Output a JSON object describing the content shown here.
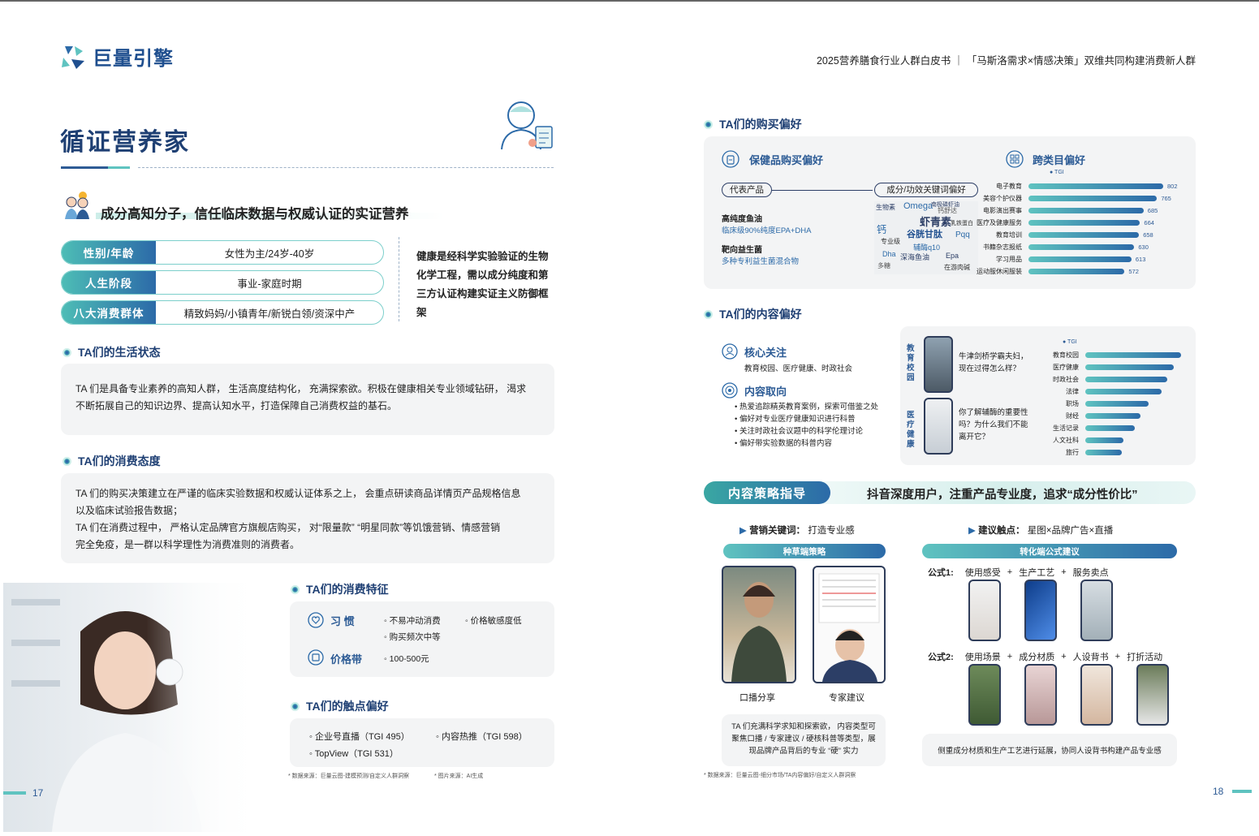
{
  "header": {
    "logo": "巨量引擎",
    "right": "2025营养膳食行业人群白皮书 ｜ 「马斯洛需求×情感决策」双维共同构建消费新人群"
  },
  "left": {
    "title": "循证营养家",
    "subhead": "成分高知分子，信任临床数据与权威认证的实证营养",
    "profile": [
      {
        "tag": "性别/年龄",
        "value": "女性为主/24岁-40岁"
      },
      {
        "tag": "人生阶段",
        "value": "事业-家庭时期"
      },
      {
        "tag": "八大消费群体",
        "value": "精致妈妈/小镇青年/新锐白领/资深中产"
      }
    ],
    "health_lines": [
      "健康是经科学实验验证的生物",
      "化学工程，需以成分纯度和第",
      "三方认证构建实证主义防御框",
      "架"
    ],
    "life": {
      "title": "TA们的生活状态",
      "lines": [
        "TA 们是具备专业素养的高知人群， 生活高度结构化， 充满探索欲。积极在健康相关专业领域钻研， 渴求",
        "不断拓展自己的知识边界、提高认知水平，打造保障自己消费权益的基石。"
      ]
    },
    "attitude": {
      "title": "TA们的消费态度",
      "lines": [
        "TA 们的购买决策建立在严谨的临床实验数据和权威认证体系之上，  会重点研读商品详情页产品规格信息",
        "以及临床试验报告数据；",
        "TA 们在消费过程中， 严格认定品牌官方旗舰店购买， 对“限量款” “明星同款”等饥饿营销、情感营销",
        "完全免疫，是一群以科学理性为消费准则的消费者。"
      ]
    },
    "features": {
      "title": "TA们的消费特征",
      "habit_label": "习  惯",
      "habit_items": [
        "◦ 不易冲动消费",
        "◦ 价格敏感度低",
        "◦ 购买频次中等"
      ],
      "price_label": "价格带",
      "price_item": "◦ 100-500元"
    },
    "touch": {
      "title": "TA们的触点偏好",
      "items": [
        "◦ 企业号直播（TGI 495）",
        "◦ 内容热推（TGI 598）",
        "◦ TopView（TGI 531）"
      ]
    },
    "source1": "* 数据来源：巨量云图-建模预测/自定义人群洞察",
    "source2": "* 图片来源：AI生成",
    "page": "17"
  },
  "right": {
    "purchase": {
      "title": "TA们的购买偏好",
      "health_title": "保健品购买偏好",
      "cross_title": "跨类目偏好",
      "rep_label": "代表产品",
      "kw_label": "成分/功效关键词偏好",
      "products": [
        {
          "name": "高纯度鱼油",
          "desc": "临床级90%纯度EPA+DHA"
        },
        {
          "name": "靶向益生菌",
          "desc": "多种专利益生菌混合物"
        }
      ],
      "wordcloud": [
        "生物素",
        "Omega",
        "钙舒达",
        "南极磷虾油",
        "虾青素",
        "谷胱甘肽",
        "钙",
        "辅酶q10",
        "专业级",
        "深海鱼油",
        "Epa",
        "Dha",
        "多糖",
        "Pqq",
        "乳铁蛋白",
        "在游肉碱"
      ],
      "tgi_label": "TGI"
    },
    "content": {
      "title": "TA们的内容偏好",
      "core_title": "核心关注",
      "core_text": "教育校园、医疗健康、时政社会",
      "orient_title": "内容取向",
      "orient_items": [
        "热爱追踪精英教育案例，探索可借鉴之处",
        "偏好对专业医疗健康知识进行科普",
        "关注时政社会议题中的科学伦理讨论",
        "偏好带实验数据的科普内容"
      ],
      "video1_tag": "教育校园",
      "video1_text": "牛津剑桥学霸夫妇，现在过得怎么样？",
      "video2_tag": "医疗健康",
      "video2_text": "你了解辅酶的重要性吗？为什么我们不能离开它？",
      "tgi_label": "TGI"
    },
    "strategy": {
      "tag": "内容策略指导",
      "headline": "抖音深度用户，注重产品专业度，追求“成分性价比”",
      "kw_label": "营销关键词：",
      "kw_value": "打造专业感",
      "touch_label": "建议触点：",
      "touch_value": "星图×品牌广告×直播",
      "seed_title": "种草端策略",
      "convert_title": "转化端公式建议",
      "cap1": "口播分享",
      "cap2": "专家建议",
      "seed_text": "TA 们充满科学求知和探索欲， 内容类型可聚焦口播 / 专家建议 / 硬核科普等类型，展现品牌产品背后的专业 “硬” 实力",
      "f1_label": "公式1:",
      "f1": [
        "使用感受",
        "生产工艺",
        "服务卖点"
      ],
      "f2_label": "公式2:",
      "f2": [
        "使用场景",
        "成分材质",
        "人设背书",
        "打折活动"
      ],
      "plus": "+",
      "convert_text": "侧重成分材质和生产工艺进行延展，协同人设背书构建产品专业感"
    },
    "source": "* 数据来源：巨量云图-细分市场/TA内容偏好/自定义人群洞察",
    "page": "18"
  },
  "chart_data": [
    {
      "type": "bar",
      "title": "跨类目偏好",
      "series": [
        {
          "name": "TGI",
          "values": [
            802,
            765,
            685,
            664,
            658,
            630,
            613,
            572
          ]
        }
      ],
      "categories": [
        "电子教育",
        "美容个护仪器",
        "电影演出赛事",
        "医疗及健康服务",
        "教育培训",
        "书籍杂志报纸",
        "学习用品",
        "运动服休闲服装"
      ]
    },
    {
      "type": "bar",
      "title": "",
      "series": [
        {
          "name": "TGI",
          "values": [
            100,
            92,
            86,
            80,
            66,
            58,
            52,
            40,
            38
          ]
        }
      ],
      "categories": [
        "教育校园",
        "医疗健康",
        "时政社会",
        "法律",
        "职场",
        "财经",
        "生活记录",
        "人文社科",
        "旅行"
      ]
    }
  ]
}
